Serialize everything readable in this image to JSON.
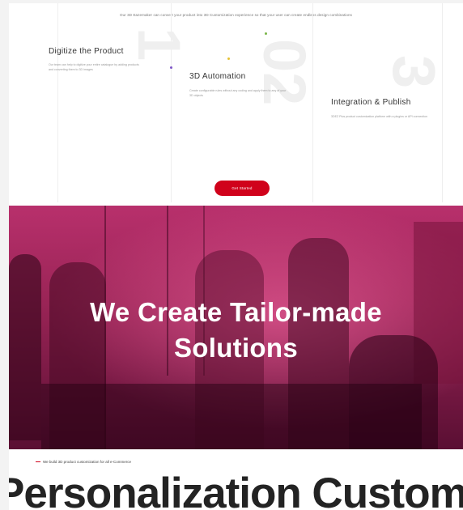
{
  "intro_text": "Our 3D Eazemaker can convert your product into 3D Customization experience so that your user can create endless design combinations",
  "steps": [
    {
      "number": "1",
      "title": "Digitize the Product",
      "description": "Our team can help to digitize your entire catalogue by adding products and converting them to 3D images"
    },
    {
      "number": "02",
      "title": "3D Automation",
      "description": "Create configurable rules without any coding and apply them to any of your 3D objects"
    },
    {
      "number": "3",
      "title": "Integration & Publish",
      "description": "3DEZ Plus product customization platform with a plugins or API connection"
    }
  ],
  "cta_label": "Get Started",
  "hero": {
    "title_line1": "We Create Tailor-made",
    "title_line2": "Solutions"
  },
  "tagline": "We build 3D product customization for all e-Commerce",
  "marquee": "Personalization Customization",
  "colors": {
    "accent": "#d0021b",
    "hero_overlay": "#b8306c",
    "heading": "#232323"
  }
}
